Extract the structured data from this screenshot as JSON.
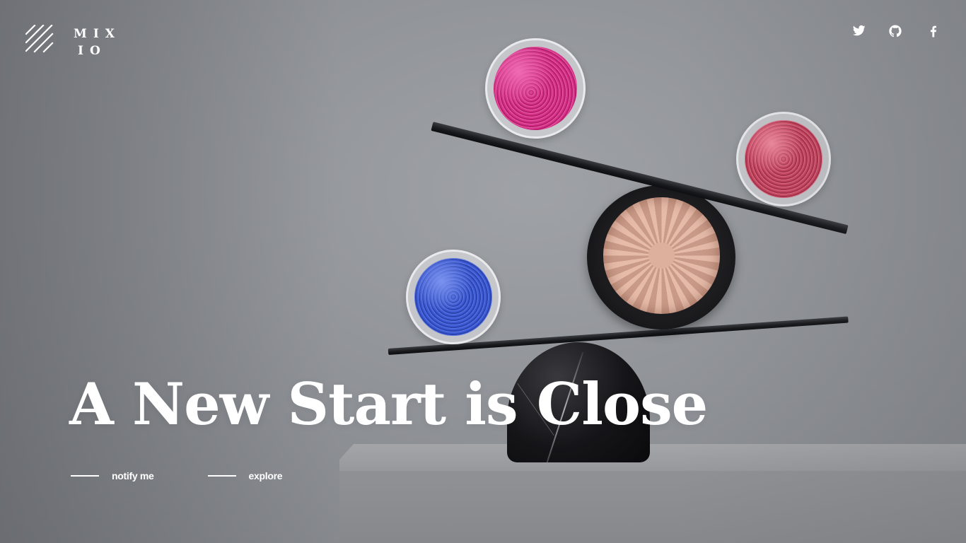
{
  "brand": {
    "logo_line1": "MIX",
    "logo_line2": "IO",
    "logo_icon": "diagonal-stripes-logo-icon"
  },
  "social": [
    {
      "name": "twitter",
      "icon": "twitter-icon"
    },
    {
      "name": "github",
      "icon": "github-icon"
    },
    {
      "name": "facebook",
      "icon": "facebook-icon"
    }
  ],
  "hero": {
    "headline": "A New Start is Close",
    "actions": [
      {
        "label": "notify me"
      },
      {
        "label": "explore"
      }
    ]
  },
  "colors": {
    "text": "#ffffff",
    "background": "#8c8f94"
  }
}
